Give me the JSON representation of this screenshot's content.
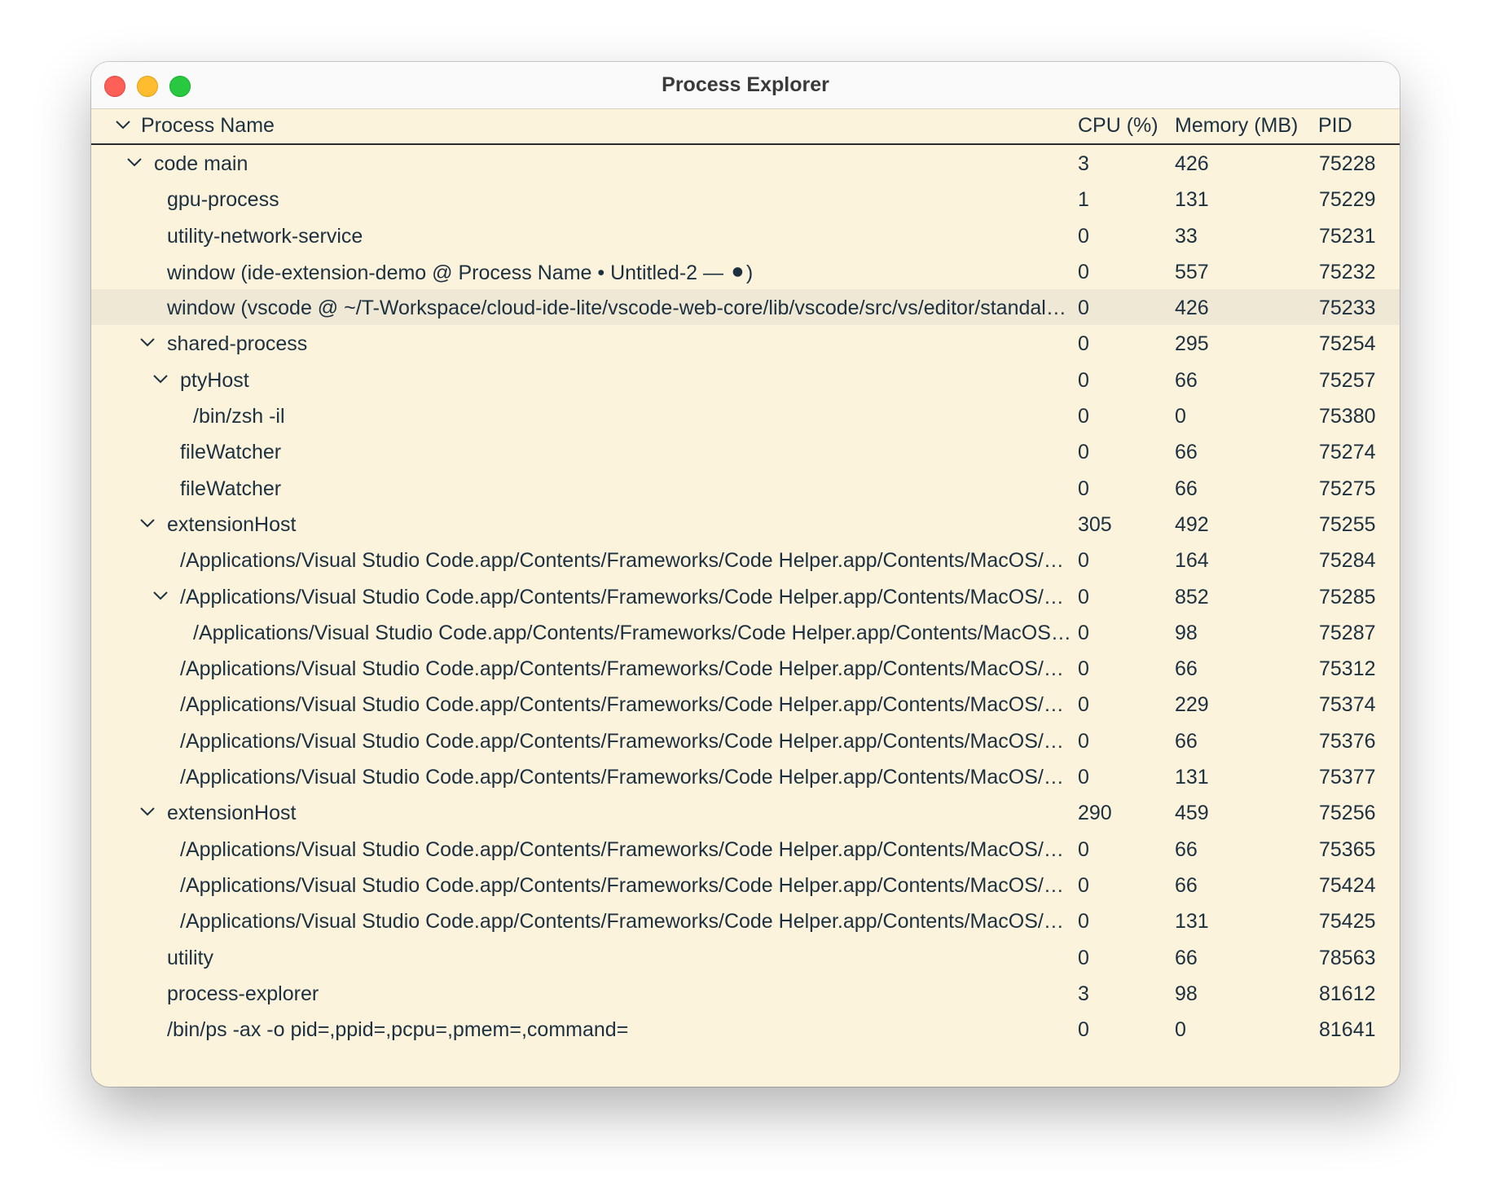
{
  "window": {
    "title": "Process Explorer"
  },
  "table": {
    "columns": {
      "name": "Process Name",
      "cpu": "CPU (%)",
      "memory": "Memory (MB)",
      "pid": "PID"
    },
    "rows": [
      {
        "name": "code main",
        "cpu": "3",
        "mem": "426",
        "pid": "75228",
        "depth": 0,
        "expandable": true
      },
      {
        "name": "gpu-process",
        "cpu": "1",
        "mem": "131",
        "pid": "75229",
        "depth": 1,
        "expandable": false
      },
      {
        "name": "utility-network-service",
        "cpu": "0",
        "mem": "33",
        "pid": "75231",
        "depth": 1,
        "expandable": false
      },
      {
        "name": "window (ide-extension-demo @ Process Name • Untitled-2 — ⚫)",
        "cpu": "0",
        "mem": "557",
        "pid": "75232",
        "depth": 1,
        "expandable": false
      },
      {
        "name": "window (vscode @ ~/T-Workspace/cloud-ide-lite/vscode-web-core/lib/vscode/src/vs/editor/standalone/browser)",
        "cpu": "0",
        "mem": "426",
        "pid": "75233",
        "depth": 1,
        "expandable": false,
        "selected": true
      },
      {
        "name": "shared-process",
        "cpu": "0",
        "mem": "295",
        "pid": "75254",
        "depth": 1,
        "expandable": true
      },
      {
        "name": "ptyHost",
        "cpu": "0",
        "mem": "66",
        "pid": "75257",
        "depth": 2,
        "expandable": true
      },
      {
        "name": "/bin/zsh -il",
        "cpu": "0",
        "mem": "0",
        "pid": "75380",
        "depth": 3,
        "expandable": false
      },
      {
        "name": "fileWatcher",
        "cpu": "0",
        "mem": "66",
        "pid": "75274",
        "depth": 2,
        "expandable": false
      },
      {
        "name": "fileWatcher",
        "cpu": "0",
        "mem": "66",
        "pid": "75275",
        "depth": 2,
        "expandable": false
      },
      {
        "name": "extensionHost",
        "cpu": "305",
        "mem": "492",
        "pid": "75255",
        "depth": 1,
        "expandable": true
      },
      {
        "name": "/Applications/Visual Studio Code.app/Contents/Frameworks/Code Helper.app/Contents/MacOS/Code Helper",
        "cpu": "0",
        "mem": "164",
        "pid": "75284",
        "depth": 2,
        "expandable": false
      },
      {
        "name": "/Applications/Visual Studio Code.app/Contents/Frameworks/Code Helper.app/Contents/MacOS/Code Helper",
        "cpu": "0",
        "mem": "852",
        "pid": "75285",
        "depth": 2,
        "expandable": true
      },
      {
        "name": "/Applications/Visual Studio Code.app/Contents/Frameworks/Code Helper.app/Contents/MacOS/Code Helper",
        "cpu": "0",
        "mem": "98",
        "pid": "75287",
        "depth": 3,
        "expandable": false
      },
      {
        "name": "/Applications/Visual Studio Code.app/Contents/Frameworks/Code Helper.app/Contents/MacOS/Code Helper",
        "cpu": "0",
        "mem": "66",
        "pid": "75312",
        "depth": 2,
        "expandable": false
      },
      {
        "name": "/Applications/Visual Studio Code.app/Contents/Frameworks/Code Helper.app/Contents/MacOS/Code Helper",
        "cpu": "0",
        "mem": "229",
        "pid": "75374",
        "depth": 2,
        "expandable": false
      },
      {
        "name": "/Applications/Visual Studio Code.app/Contents/Frameworks/Code Helper.app/Contents/MacOS/Code Helper",
        "cpu": "0",
        "mem": "66",
        "pid": "75376",
        "depth": 2,
        "expandable": false
      },
      {
        "name": "/Applications/Visual Studio Code.app/Contents/Frameworks/Code Helper.app/Contents/MacOS/Code Helper",
        "cpu": "0",
        "mem": "131",
        "pid": "75377",
        "depth": 2,
        "expandable": false
      },
      {
        "name": "extensionHost",
        "cpu": "290",
        "mem": "459",
        "pid": "75256",
        "depth": 1,
        "expandable": true
      },
      {
        "name": "/Applications/Visual Studio Code.app/Contents/Frameworks/Code Helper.app/Contents/MacOS/Code Helper",
        "cpu": "0",
        "mem": "66",
        "pid": "75365",
        "depth": 2,
        "expandable": false
      },
      {
        "name": "/Applications/Visual Studio Code.app/Contents/Frameworks/Code Helper.app/Contents/MacOS/Code Helper",
        "cpu": "0",
        "mem": "66",
        "pid": "75424",
        "depth": 2,
        "expandable": false
      },
      {
        "name": "/Applications/Visual Studio Code.app/Contents/Frameworks/Code Helper.app/Contents/MacOS/Code Helper",
        "cpu": "0",
        "mem": "131",
        "pid": "75425",
        "depth": 2,
        "expandable": false
      },
      {
        "name": "utility",
        "cpu": "0",
        "mem": "66",
        "pid": "78563",
        "depth": 1,
        "expandable": false
      },
      {
        "name": "process-explorer",
        "cpu": "3",
        "mem": "98",
        "pid": "81612",
        "depth": 1,
        "expandable": false
      },
      {
        "name": "/bin/ps -ax -o pid=,ppid=,pcpu=,pmem=,command=",
        "cpu": "0",
        "mem": "0",
        "pid": "81641",
        "depth": 1,
        "expandable": false
      }
    ]
  }
}
